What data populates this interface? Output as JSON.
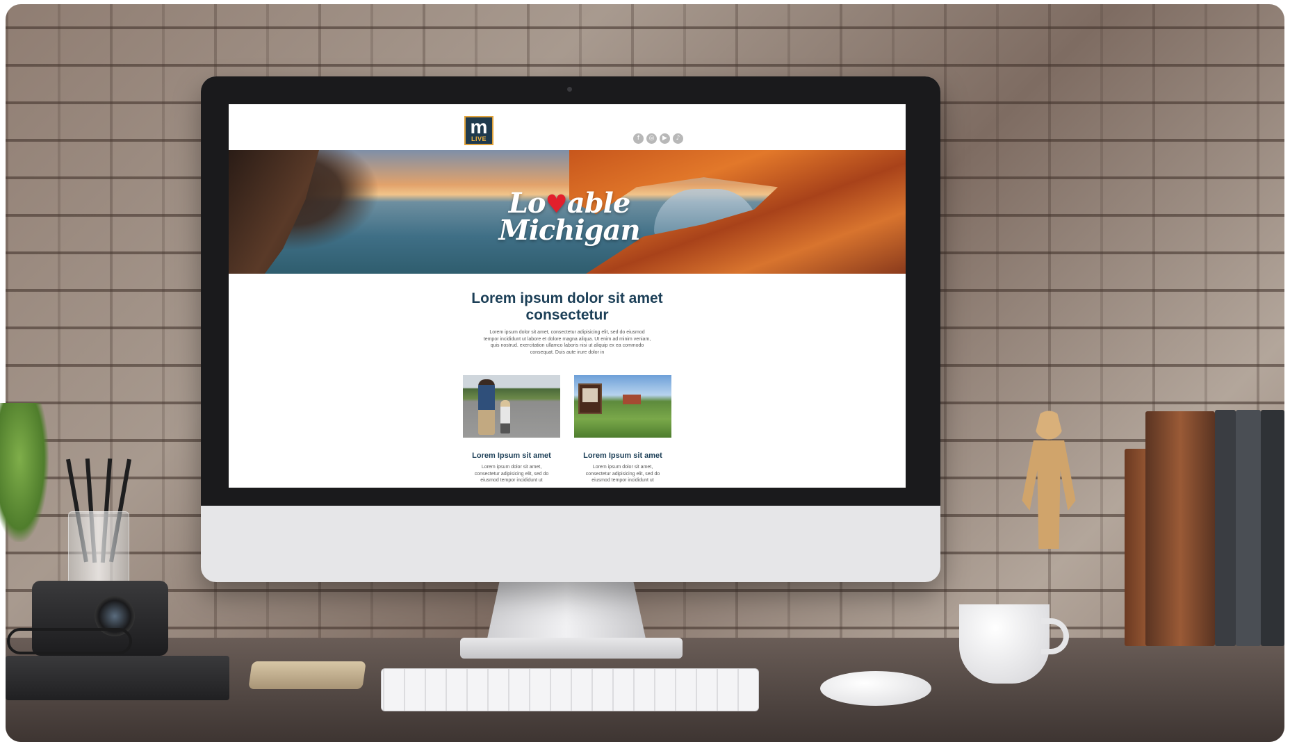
{
  "email": {
    "logo": {
      "letter": "m",
      "sub": "LIVE"
    },
    "socials": [
      {
        "icon": "facebook-icon",
        "glyph": "f"
      },
      {
        "icon": "instagram-icon",
        "glyph": "◎"
      },
      {
        "icon": "youtube-icon",
        "glyph": "▶"
      },
      {
        "icon": "tiktok-icon",
        "glyph": "♪"
      }
    ],
    "hero": {
      "title_part1": "Lo",
      "title_part2": "able",
      "title_line2": "Michigan"
    },
    "headline": "Lorem ipsum dolor sit amet consectetur",
    "body": "Lorem ipsum dolor sit amet, consectetur adipisicing elit, sed do eiusmod tempor incididunt ut labore et dolore magna aliqua. Ut enim ad minim veniam, quis nostrud. exercitation ullamco laboris nisi ut aliquip ex ea commodo consequat. Duis aute irure dolor in",
    "cards": [
      {
        "title": "Lorem Ipsum sit amet",
        "copy": "Lorem ipsum dolor sit amet, consectetur adipisicing elit, sed do eiusmod tempor incididunt ut"
      },
      {
        "title": "Lorem Ipsum sit amet",
        "copy": "Lorem ipsum dolor sit amet, consectetur adipisicing elit, sed do eiusmod tempor incididunt ut"
      }
    ]
  },
  "colors": {
    "navy": "#1c3f57",
    "logo_bg": "#1f3a4d",
    "logo_accent": "#e0a23a",
    "heart": "#e21f2c"
  }
}
